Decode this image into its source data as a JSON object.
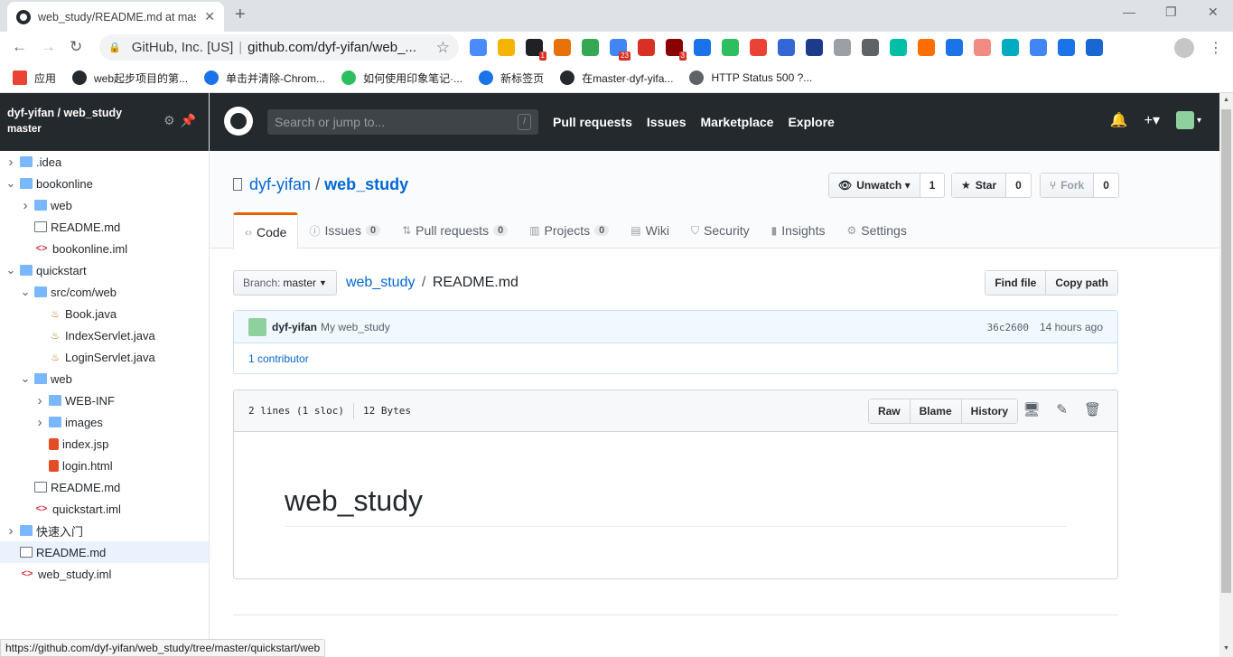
{
  "browser": {
    "tab_title": "web_study/README.md at master",
    "new_tab": "+",
    "window_buttons": [
      "—",
      "❐",
      "✕"
    ],
    "omnibox": {
      "site": "GitHub, Inc. [US]",
      "separator": "|",
      "url": "github.com/dyf-yifan/web_..."
    },
    "bookmarks": [
      {
        "label": "应用",
        "icon": "apps-grid-icon",
        "color": "#ea4335"
      },
      {
        "label": "web起步项目的第...",
        "icon": "github-icon",
        "color": "#24292e"
      },
      {
        "label": "单击并清除-Chrom...",
        "icon": "chrome-store-icon",
        "color": "#1a73e8"
      },
      {
        "label": "如何使用印象笔记·...",
        "icon": "evernote-icon",
        "color": "#2dbe60"
      },
      {
        "label": "新标签页",
        "icon": "newtab-icon",
        "color": "#1a73e8"
      },
      {
        "label": "在master·dyf-yifa...",
        "icon": "github-icon",
        "color": "#24292e"
      },
      {
        "label": "HTTP Status 500 ?...",
        "icon": "globe-icon",
        "color": "#5f6368"
      }
    ],
    "extensions": [
      {
        "color": "#4a8cff",
        "badge": ""
      },
      {
        "color": "#f4b400",
        "badge": ""
      },
      {
        "color": "#202124",
        "badge": "1"
      },
      {
        "color": "#e8710a",
        "badge": ""
      },
      {
        "color": "#34a853",
        "badge": ""
      },
      {
        "color": "#4285f4",
        "badge": "23"
      },
      {
        "color": "#d93025",
        "badge": ""
      },
      {
        "color": "#8b0000",
        "badge": "3"
      },
      {
        "color": "#1a73e8",
        "badge": ""
      },
      {
        "color": "#2dbe60",
        "badge": ""
      },
      {
        "color": "#ea4335",
        "badge": ""
      },
      {
        "color": "#3367d6",
        "badge": ""
      },
      {
        "color": "#1e3a8a",
        "badge": ""
      },
      {
        "color": "#9aa0a6",
        "badge": ""
      },
      {
        "color": "#5f6368",
        "badge": ""
      },
      {
        "color": "#00bfa5",
        "badge": ""
      },
      {
        "color": "#ff6d00",
        "badge": ""
      },
      {
        "color": "#1a73e8",
        "badge": ""
      },
      {
        "color": "#f28b82",
        "badge": ""
      },
      {
        "color": "#00acc1",
        "badge": ""
      },
      {
        "color": "#4285f4",
        "badge": ""
      },
      {
        "color": "#1a73e8",
        "badge": ""
      },
      {
        "color": "#1967d2",
        "badge": ""
      }
    ],
    "status_url": "https://github.com/dyf-yifan/web_study/tree/master/quickstart/web"
  },
  "sidebar": {
    "repo": "dyf-yifan / web_study",
    "branch": "master",
    "tree": [
      {
        "label": ".idea",
        "type": "folder",
        "depth": 0,
        "open": false
      },
      {
        "label": "bookonline",
        "type": "folder",
        "depth": 0,
        "open": true
      },
      {
        "label": "web",
        "type": "folder",
        "depth": 1,
        "open": false
      },
      {
        "label": "README.md",
        "type": "doc",
        "depth": 1
      },
      {
        "label": "bookonline.iml",
        "type": "code",
        "depth": 1
      },
      {
        "label": "quickstart",
        "type": "folder",
        "depth": 0,
        "open": true
      },
      {
        "label": "src/com/web",
        "type": "folder",
        "depth": 1,
        "open": true
      },
      {
        "label": "Book.java",
        "type": "java",
        "depth": 2
      },
      {
        "label": "IndexServlet.java",
        "type": "java",
        "depth": 2
      },
      {
        "label": "LoginServlet.java",
        "type": "java",
        "depth": 2
      },
      {
        "label": "web",
        "type": "folder",
        "depth": 1,
        "open": true
      },
      {
        "label": "WEB-INF",
        "type": "folder",
        "depth": 2,
        "open": false
      },
      {
        "label": "images",
        "type": "folder",
        "depth": 2,
        "open": false
      },
      {
        "label": "index.jsp",
        "type": "html",
        "depth": 2
      },
      {
        "label": "login.html",
        "type": "html",
        "depth": 2
      },
      {
        "label": "README.md",
        "type": "doc",
        "depth": 1
      },
      {
        "label": "quickstart.iml",
        "type": "code",
        "depth": 1
      },
      {
        "label": "快速入门",
        "type": "folder",
        "depth": 0,
        "open": false
      },
      {
        "label": "README.md",
        "type": "doc",
        "depth": 0,
        "selected": true
      },
      {
        "label": "web_study.iml",
        "type": "code",
        "depth": 0
      }
    ]
  },
  "header": {
    "search_placeholder": "Search or jump to...",
    "search_key": "/",
    "nav": [
      "Pull requests",
      "Issues",
      "Marketplace",
      "Explore"
    ]
  },
  "repo": {
    "owner": "dyf-yifan",
    "slash": "/",
    "name": "web_study",
    "unwatch": {
      "label": "Unwatch ▾",
      "count": "1"
    },
    "star": {
      "label": "Star",
      "count": "0"
    },
    "fork": {
      "label": "Fork",
      "count": "0"
    },
    "tabs": [
      {
        "label": "Code",
        "count": ""
      },
      {
        "label": "Issues",
        "count": "0"
      },
      {
        "label": "Pull requests",
        "count": "0"
      },
      {
        "label": "Projects",
        "count": "0"
      },
      {
        "label": "Wiki",
        "count": ""
      },
      {
        "label": "Security",
        "count": ""
      },
      {
        "label": "Insights",
        "count": ""
      },
      {
        "label": "Settings",
        "count": ""
      }
    ]
  },
  "file": {
    "branch_label": "Branch:",
    "branch": "master",
    "crumb_repo": "web_study",
    "crumb_sep": "/",
    "crumb_file": "README.md",
    "find_file": "Find file",
    "copy_path": "Copy path",
    "commit": {
      "author": "dyf-yifan",
      "message": "My web_study",
      "sha": "36c2600",
      "time": "14 hours ago"
    },
    "contributors": "1 contributor",
    "lines": "2 lines (1 sloc)",
    "size": "12 Bytes",
    "buttons": [
      "Raw",
      "Blame",
      "History"
    ],
    "readme_heading": "web_study"
  }
}
